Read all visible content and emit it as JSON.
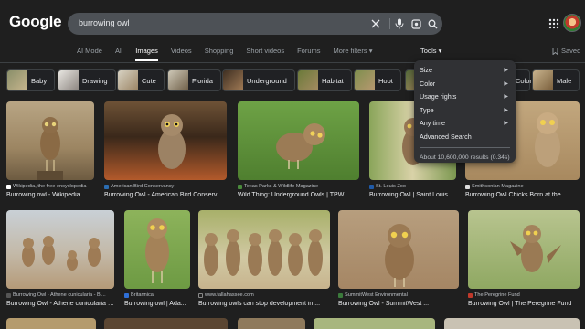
{
  "logo": "Google",
  "search": {
    "query": "burrowing owl"
  },
  "tabs": [
    "AI Mode",
    "All",
    "Images",
    "Videos",
    "Shopping",
    "Short videos",
    "Forums",
    "More filters ▾"
  ],
  "active_tab": "Images",
  "tools_label": "Tools ▾",
  "saved_label": "Saved",
  "chips": [
    "Baby",
    "Drawing",
    "Cute",
    "Florida",
    "Underground",
    "Habitat",
    "Hoot",
    "Color",
    "Male"
  ],
  "dropdown": {
    "items": [
      "Size",
      "Color",
      "Usage rights",
      "Type",
      "Any time",
      "Advanced Search"
    ],
    "results": "About 10,600,000 results (0.34s)"
  },
  "results_row1": [
    {
      "source": "Wikipedia, the free encyclopedia",
      "title": "Burrowing owl - Wikipedia"
    },
    {
      "source": "American Bird Conservancy",
      "title": "Burrowing Owl - American Bird Conservan..."
    },
    {
      "source": "Texas Parks & Wildlife Magazine",
      "title": "Wild Thing: Underground Owls | TPW ..."
    },
    {
      "source": "St. Louis Zoo",
      "title": "Burrowing Owl | Saint Louis ..."
    },
    {
      "source": "Smithsonian Magazine",
      "title": "Burrowing Owl Chicks Born at the ..."
    }
  ],
  "results_row2": [
    {
      "source": "Burrowing Owl - Athene cunicularia - Bi...",
      "title": "Burrowing Owl - Athene cunicularia - Bi..."
    },
    {
      "source": "Britannica",
      "title": "Burrowing owl | Ada..."
    },
    {
      "source": "www.tallahassee.com",
      "title": "Burrowing owls can stop development in ..."
    },
    {
      "source": "SummitWest Environmental",
      "title": "Burrowing Owl - SummitWest ..."
    },
    {
      "source": "The Peregrine Fund",
      "title": "Burrowing Owl | The Peregrine Fund"
    }
  ],
  "colors": {
    "background": "#1f1f1f",
    "searchbox": "#4d5156",
    "dropdown": "#303134"
  }
}
